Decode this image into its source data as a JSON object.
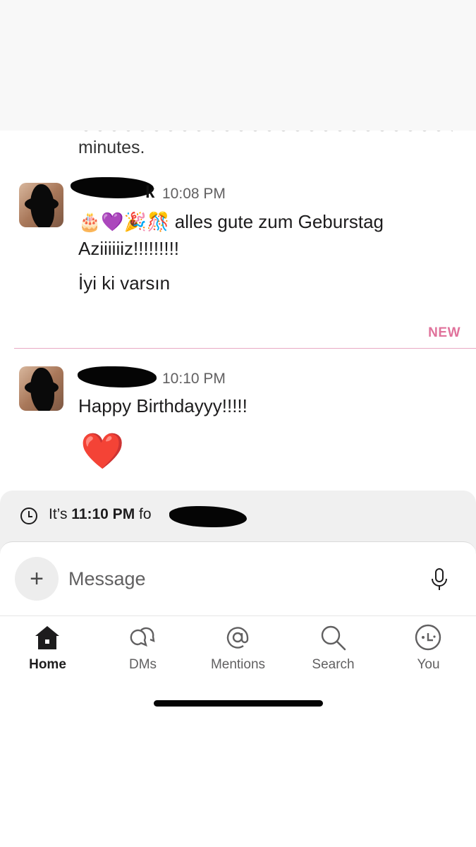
{
  "messages": [
    {
      "name_visible": "k",
      "time": "10:08 PM",
      "emojis": "🎂💜🎉🎊",
      "line1": "alles gute zum Geburstag",
      "line2": "Aziiiiiiz!!!!!!!!!",
      "line3": "İyi ki varsın"
    },
    {
      "time": "10:10 PM",
      "line1": "Happy Birthdayyy!!!!!",
      "emoji": "❤️"
    }
  ],
  "previous_message_tail": "minutes.",
  "divider": {
    "label": "NEW"
  },
  "timezone_banner": {
    "prefix": "It’s ",
    "time": "11:10 PM",
    "suffix": " fo"
  },
  "composer": {
    "placeholder": "Message",
    "plus_icon": "plus-icon",
    "mic_icon": "microphone-icon"
  },
  "tabs": [
    {
      "label": "Home",
      "icon": "home-icon",
      "active": true
    },
    {
      "label": "DMs",
      "icon": "dms-icon",
      "active": false
    },
    {
      "label": "Mentions",
      "icon": "at-icon",
      "active": false
    },
    {
      "label": "Search",
      "icon": "search-icon",
      "active": false
    },
    {
      "label": "You",
      "icon": "profile-icon",
      "active": false
    }
  ],
  "colors": {
    "new_divider": "#e0729b",
    "text": "#1d1c1d",
    "muted": "#616061",
    "heart": "#e0212b"
  }
}
